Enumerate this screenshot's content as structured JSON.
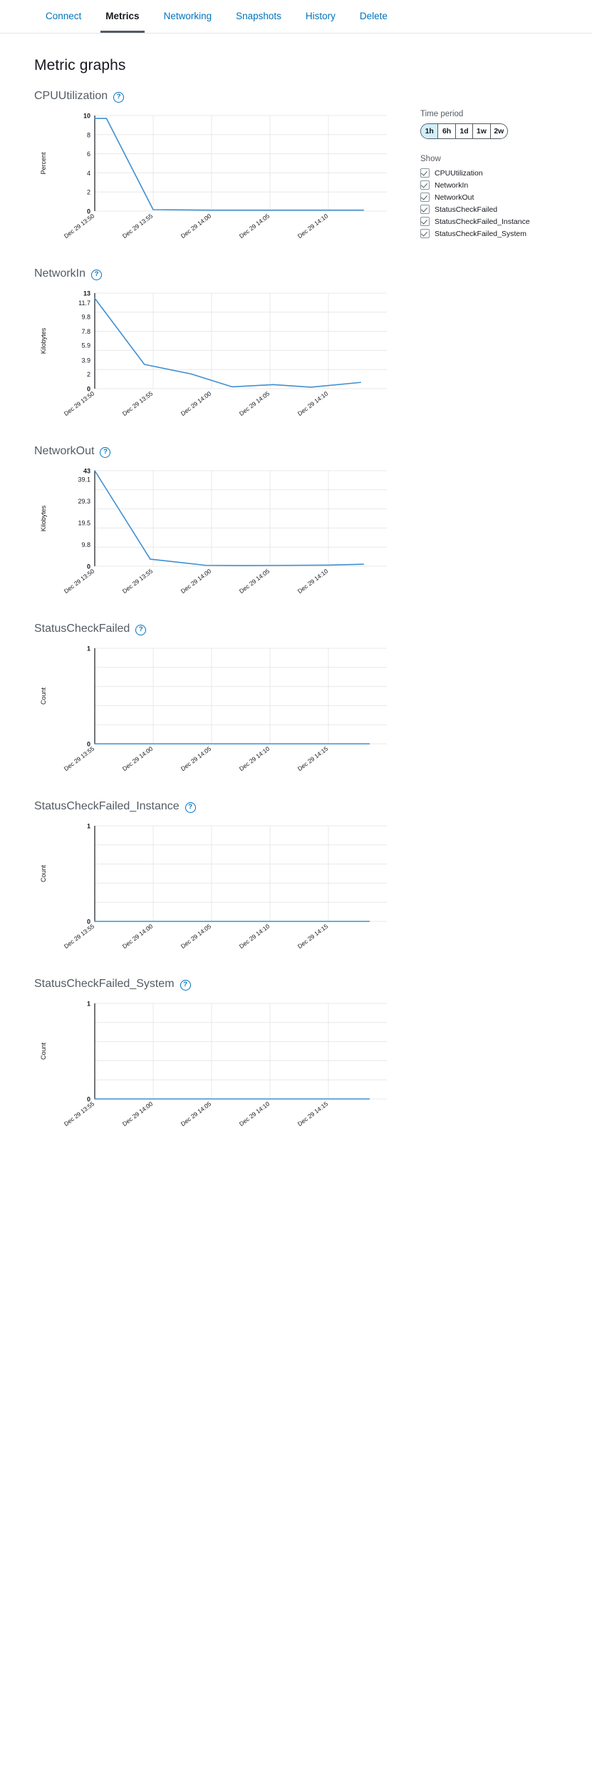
{
  "tabs": [
    {
      "label": "Connect",
      "active": false
    },
    {
      "label": "Metrics",
      "active": true
    },
    {
      "label": "Networking",
      "active": false
    },
    {
      "label": "Snapshots",
      "active": false
    },
    {
      "label": "History",
      "active": false
    },
    {
      "label": "Delete",
      "active": false
    }
  ],
  "page": {
    "title": "Metric graphs"
  },
  "sidebar": {
    "time_period_label": "Time period",
    "time_period_options": [
      "1h",
      "6h",
      "1d",
      "1w",
      "2w"
    ],
    "time_period_selected": "1h",
    "show_label": "Show",
    "metrics": [
      {
        "label": "CPUUtilization",
        "checked": true
      },
      {
        "label": "NetworkIn",
        "checked": true
      },
      {
        "label": "NetworkOut",
        "checked": true
      },
      {
        "label": "StatusCheckFailed",
        "checked": true
      },
      {
        "label": "StatusCheckFailed_Instance",
        "checked": true
      },
      {
        "label": "StatusCheckFailed_System",
        "checked": true
      }
    ]
  },
  "colors": {
    "accent": "#0073bb",
    "line": "#3f8fd2",
    "grid": "#e8e8e8",
    "axis": "#16191f",
    "title": "#545b64",
    "selected_segment": "#d1effa"
  },
  "help_icon": "?",
  "chart_data": [
    {
      "type": "line",
      "title": "CPUUtilization",
      "xlabel": "",
      "ylabel": "Percent",
      "ylim": [
        0,
        10
      ],
      "yticks": [
        0,
        2,
        4,
        6,
        8,
        10
      ],
      "xticks": [
        "Dec 29 13:50",
        "Dec 29 13:55",
        "Dec 29 14:00",
        "Dec 29 14:05",
        "Dec 29 14:10"
      ],
      "grid": true,
      "legend": "none",
      "x": [
        0,
        0.2,
        1,
        2,
        3,
        4,
        4.6
      ],
      "values": [
        9.7,
        9.7,
        0.15,
        0.1,
        0.1,
        0.1,
        0.1
      ],
      "series": [
        {
          "name": "CPUUtilization",
          "values": [
            9.7,
            9.7,
            0.15,
            0.1,
            0.1,
            0.1,
            0.1
          ]
        }
      ]
    },
    {
      "type": "line",
      "title": "NetworkIn",
      "xlabel": "",
      "ylabel": "Kilobytes",
      "ylim": [
        0,
        13
      ],
      "yticks": [
        0,
        2,
        3.9,
        5.9,
        7.8,
        9.8,
        11.7,
        13
      ],
      "xticks": [
        "Dec 29 13:50",
        "Dec 29 13:55",
        "Dec 29 14:00",
        "Dec 29 14:05",
        "Dec 29 14:10"
      ],
      "grid": true,
      "legend": "none",
      "x": [
        0,
        0.85,
        1.65,
        2.35,
        3.05,
        3.7,
        4.55
      ],
      "values": [
        12.3,
        3.3,
        2.0,
        0.25,
        0.55,
        0.2,
        0.85
      ],
      "series": [
        {
          "name": "NetworkIn",
          "values": [
            12.3,
            3.3,
            2.0,
            0.25,
            0.55,
            0.2,
            0.85
          ]
        }
      ]
    },
    {
      "type": "line",
      "title": "NetworkOut",
      "xlabel": "",
      "ylabel": "Kilobytes",
      "ylim": [
        0,
        43
      ],
      "yticks": [
        0,
        9.8,
        19.5,
        29.3,
        39.1,
        43
      ],
      "xticks": [
        "Dec 29 13:50",
        "Dec 29 13:55",
        "Dec 29 14:00",
        "Dec 29 14:05",
        "Dec 29 14:10"
      ],
      "grid": true,
      "legend": "none",
      "x": [
        0,
        0.95,
        1.9,
        2.6,
        3.3,
        4.0,
        4.6
      ],
      "values": [
        43,
        3.2,
        0.4,
        0.3,
        0.4,
        0.5,
        0.9
      ],
      "series": [
        {
          "name": "NetworkOut",
          "values": [
            43,
            3.2,
            0.4,
            0.3,
            0.4,
            0.5,
            0.9
          ]
        }
      ]
    },
    {
      "type": "line",
      "title": "StatusCheckFailed",
      "xlabel": "",
      "ylabel": "Count",
      "ylim": [
        0,
        1
      ],
      "yticks": [
        0,
        1
      ],
      "xticks": [
        "Dec 29 13:55",
        "Dec 29 14:00",
        "Dec 29 14:05",
        "Dec 29 14:10",
        "Dec 29 14:15"
      ],
      "grid": true,
      "legend": "none",
      "x": [
        0,
        1,
        2,
        3,
        4,
        4.7
      ],
      "values": [
        0,
        0,
        0,
        0,
        0,
        0
      ],
      "series": [
        {
          "name": "StatusCheckFailed",
          "values": [
            0,
            0,
            0,
            0,
            0,
            0
          ]
        }
      ]
    },
    {
      "type": "line",
      "title": "StatusCheckFailed_Instance",
      "xlabel": "",
      "ylabel": "Count",
      "ylim": [
        0,
        1
      ],
      "yticks": [
        0,
        1
      ],
      "xticks": [
        "Dec 29 13:55",
        "Dec 29 14:00",
        "Dec 29 14:05",
        "Dec 29 14:10",
        "Dec 29 14:15"
      ],
      "grid": true,
      "legend": "none",
      "x": [
        0,
        1,
        2,
        3,
        4,
        4.7
      ],
      "values": [
        0,
        0,
        0,
        0,
        0,
        0
      ],
      "series": [
        {
          "name": "StatusCheckFailed_Instance",
          "values": [
            0,
            0,
            0,
            0,
            0,
            0
          ]
        }
      ]
    },
    {
      "type": "line",
      "title": "StatusCheckFailed_System",
      "xlabel": "",
      "ylabel": "Count",
      "ylim": [
        0,
        1
      ],
      "yticks": [
        0,
        1
      ],
      "xticks": [
        "Dec 29 13:55",
        "Dec 29 14:00",
        "Dec 29 14:05",
        "Dec 29 14:10",
        "Dec 29 14:15"
      ],
      "grid": true,
      "legend": "none",
      "x": [
        0,
        1,
        2,
        3,
        4,
        4.7
      ],
      "values": [
        0,
        0,
        0,
        0,
        0,
        0
      ],
      "series": [
        {
          "name": "StatusCheckFailed_System",
          "values": [
            0,
            0,
            0,
            0,
            0,
            0
          ]
        }
      ]
    }
  ]
}
